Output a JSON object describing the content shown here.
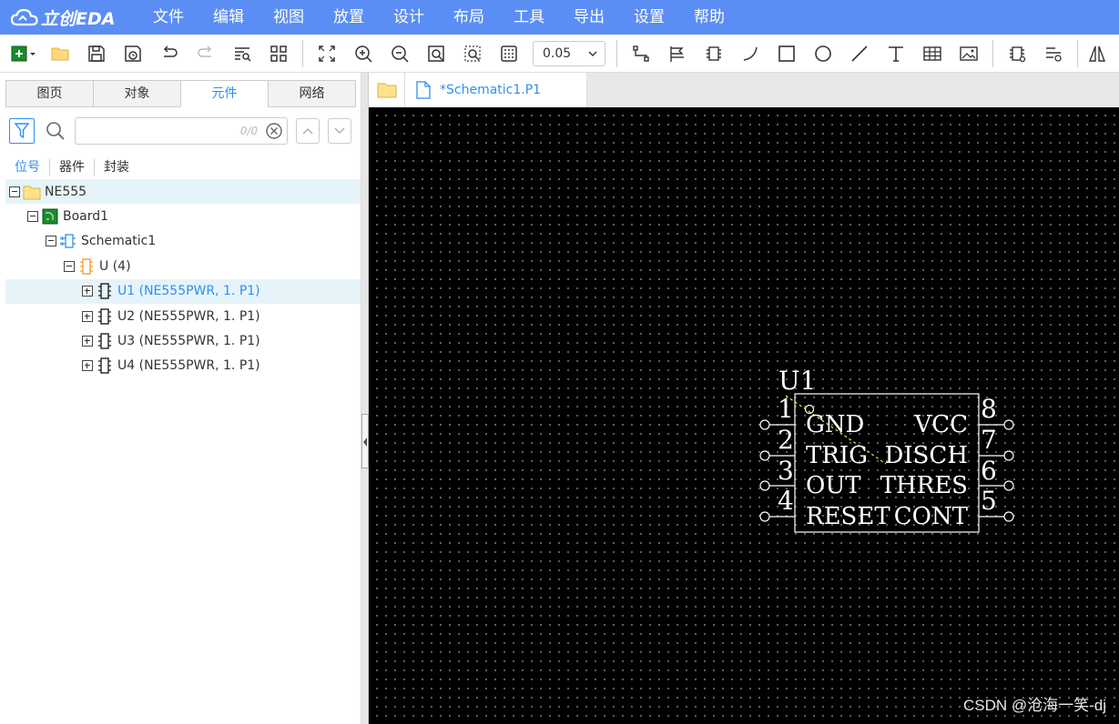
{
  "app": {
    "logo_text": "立创EDA",
    "menu": [
      "文件",
      "编辑",
      "视图",
      "放置",
      "设计",
      "布局",
      "工具",
      "导出",
      "设置",
      "帮助"
    ]
  },
  "toolbar": {
    "zoom_value": "0.05"
  },
  "left_panel": {
    "tabs": [
      "图页",
      "对象",
      "元件",
      "网络"
    ],
    "active_tab": "元件",
    "search": {
      "value": "",
      "count": "0/0"
    },
    "subtabs": [
      "位号",
      "器件",
      "封装"
    ],
    "tree": [
      {
        "label": "NE555",
        "icon": "folder-icon",
        "depth": 0
      },
      {
        "label": "Board1",
        "icon": "board-icon",
        "depth": 1
      },
      {
        "label": "Schematic1",
        "icon": "schematic-icon",
        "depth": 2
      },
      {
        "label": "U (4)",
        "icon": "component-group-icon",
        "depth": 3
      },
      {
        "label": "U1 (NE555PWR, 1. P1)",
        "icon": "chip-icon",
        "depth": 4
      },
      {
        "label": "U2 (NE555PWR, 1. P1)",
        "icon": "chip-icon",
        "depth": 4
      },
      {
        "label": "U3 (NE555PWR, 1. P1)",
        "icon": "chip-icon",
        "depth": 4
      },
      {
        "label": "U4 (NE555PWR, 1. P1)",
        "icon": "chip-icon",
        "depth": 4
      }
    ]
  },
  "document": {
    "tab_title": "*Schematic1.P1"
  },
  "schematic": {
    "designator": "U1",
    "left_pins": [
      {
        "num": "1",
        "name": "GND"
      },
      {
        "num": "2",
        "name": "TRIG"
      },
      {
        "num": "3",
        "name": "OUT"
      },
      {
        "num": "4",
        "name": "RESET"
      }
    ],
    "right_pins": [
      {
        "num": "8",
        "name": "VCC"
      },
      {
        "num": "7",
        "name": "DISCH"
      },
      {
        "num": "6",
        "name": "THRES"
      },
      {
        "num": "5",
        "name": "CONT"
      }
    ]
  },
  "watermark": "CSDN @沧海一笑-dj",
  "colors": {
    "menubar": "#5b8ef5",
    "accent": "#2f8ef4",
    "canvas": "#000000",
    "symbol": "#ffffff"
  }
}
